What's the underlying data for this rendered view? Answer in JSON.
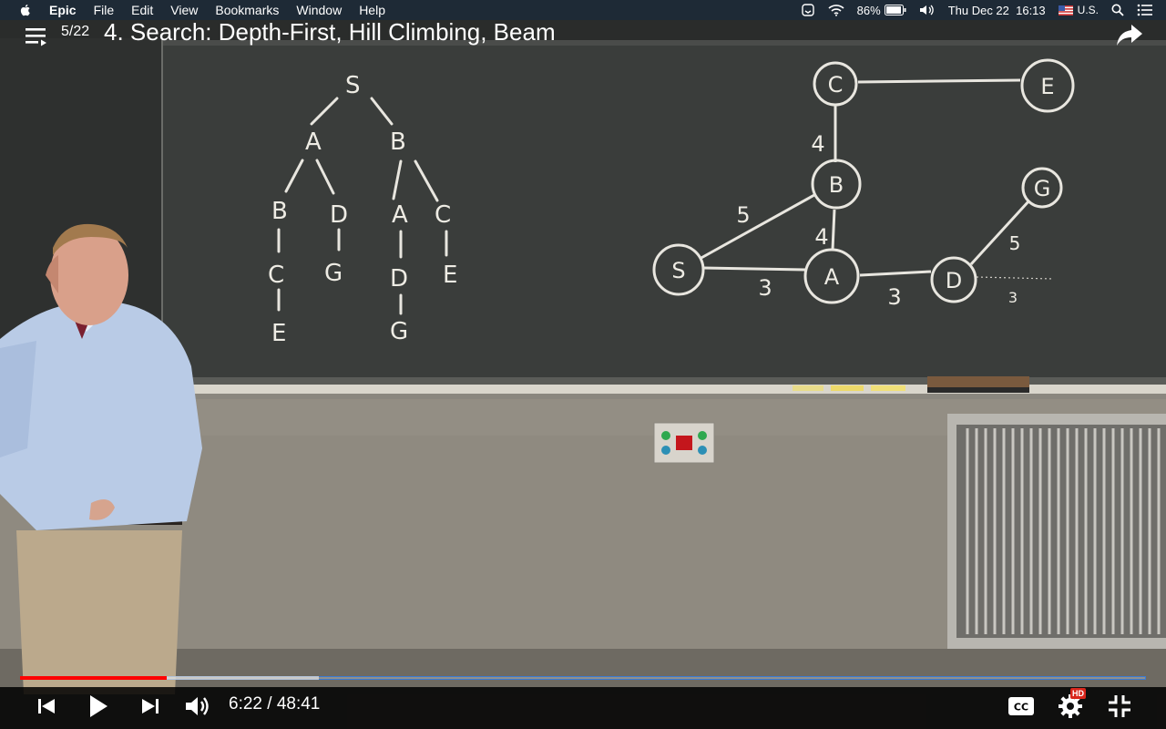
{
  "menubar": {
    "app_name": "Epic",
    "menus": [
      "File",
      "Edit",
      "View",
      "Bookmarks",
      "Window",
      "Help"
    ],
    "battery": "86%",
    "datetime": "Thu Dec 22  16:13",
    "input_source": "U.S."
  },
  "player": {
    "playlist_position": "5/22",
    "title": "4. Search: Depth-First, Hill Climbing, Beam",
    "played_fraction": 0.13,
    "buffered_fraction": 0.265,
    "time_display": "6:22 / 48:41",
    "quality_badge": "HD"
  },
  "blackboard": {
    "tree_labels": [
      "S",
      "A",
      "B",
      "B",
      "D",
      "A",
      "C",
      "C",
      "G",
      "D",
      "E",
      "E",
      "G"
    ],
    "graph_nodes": [
      "C",
      "E",
      "B",
      "G",
      "S",
      "A",
      "D"
    ],
    "edge_weights": [
      "4",
      "5",
      "4",
      "5",
      "3",
      "3",
      "3"
    ]
  },
  "colors": {
    "menubar_bg": "#1e2a36",
    "chalkboard": "#3a3d3b",
    "wall": "#8f8a80",
    "progress_played": "#ff0000",
    "hd_badge": "#d9261c"
  }
}
